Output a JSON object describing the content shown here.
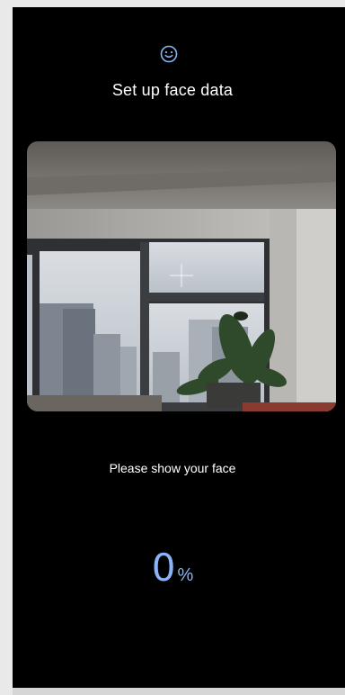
{
  "header": {
    "icon": "smiley-face-icon",
    "title": "Set up face data"
  },
  "camera": {
    "view": "camera-preview",
    "overlay_icon": "crosshair-plus-icon"
  },
  "instruction": "Please show your face",
  "progress": {
    "value": "0",
    "unit": "%"
  },
  "colors": {
    "background": "#000000",
    "accent": "#8ab4f8",
    "text": "#ffffff"
  }
}
